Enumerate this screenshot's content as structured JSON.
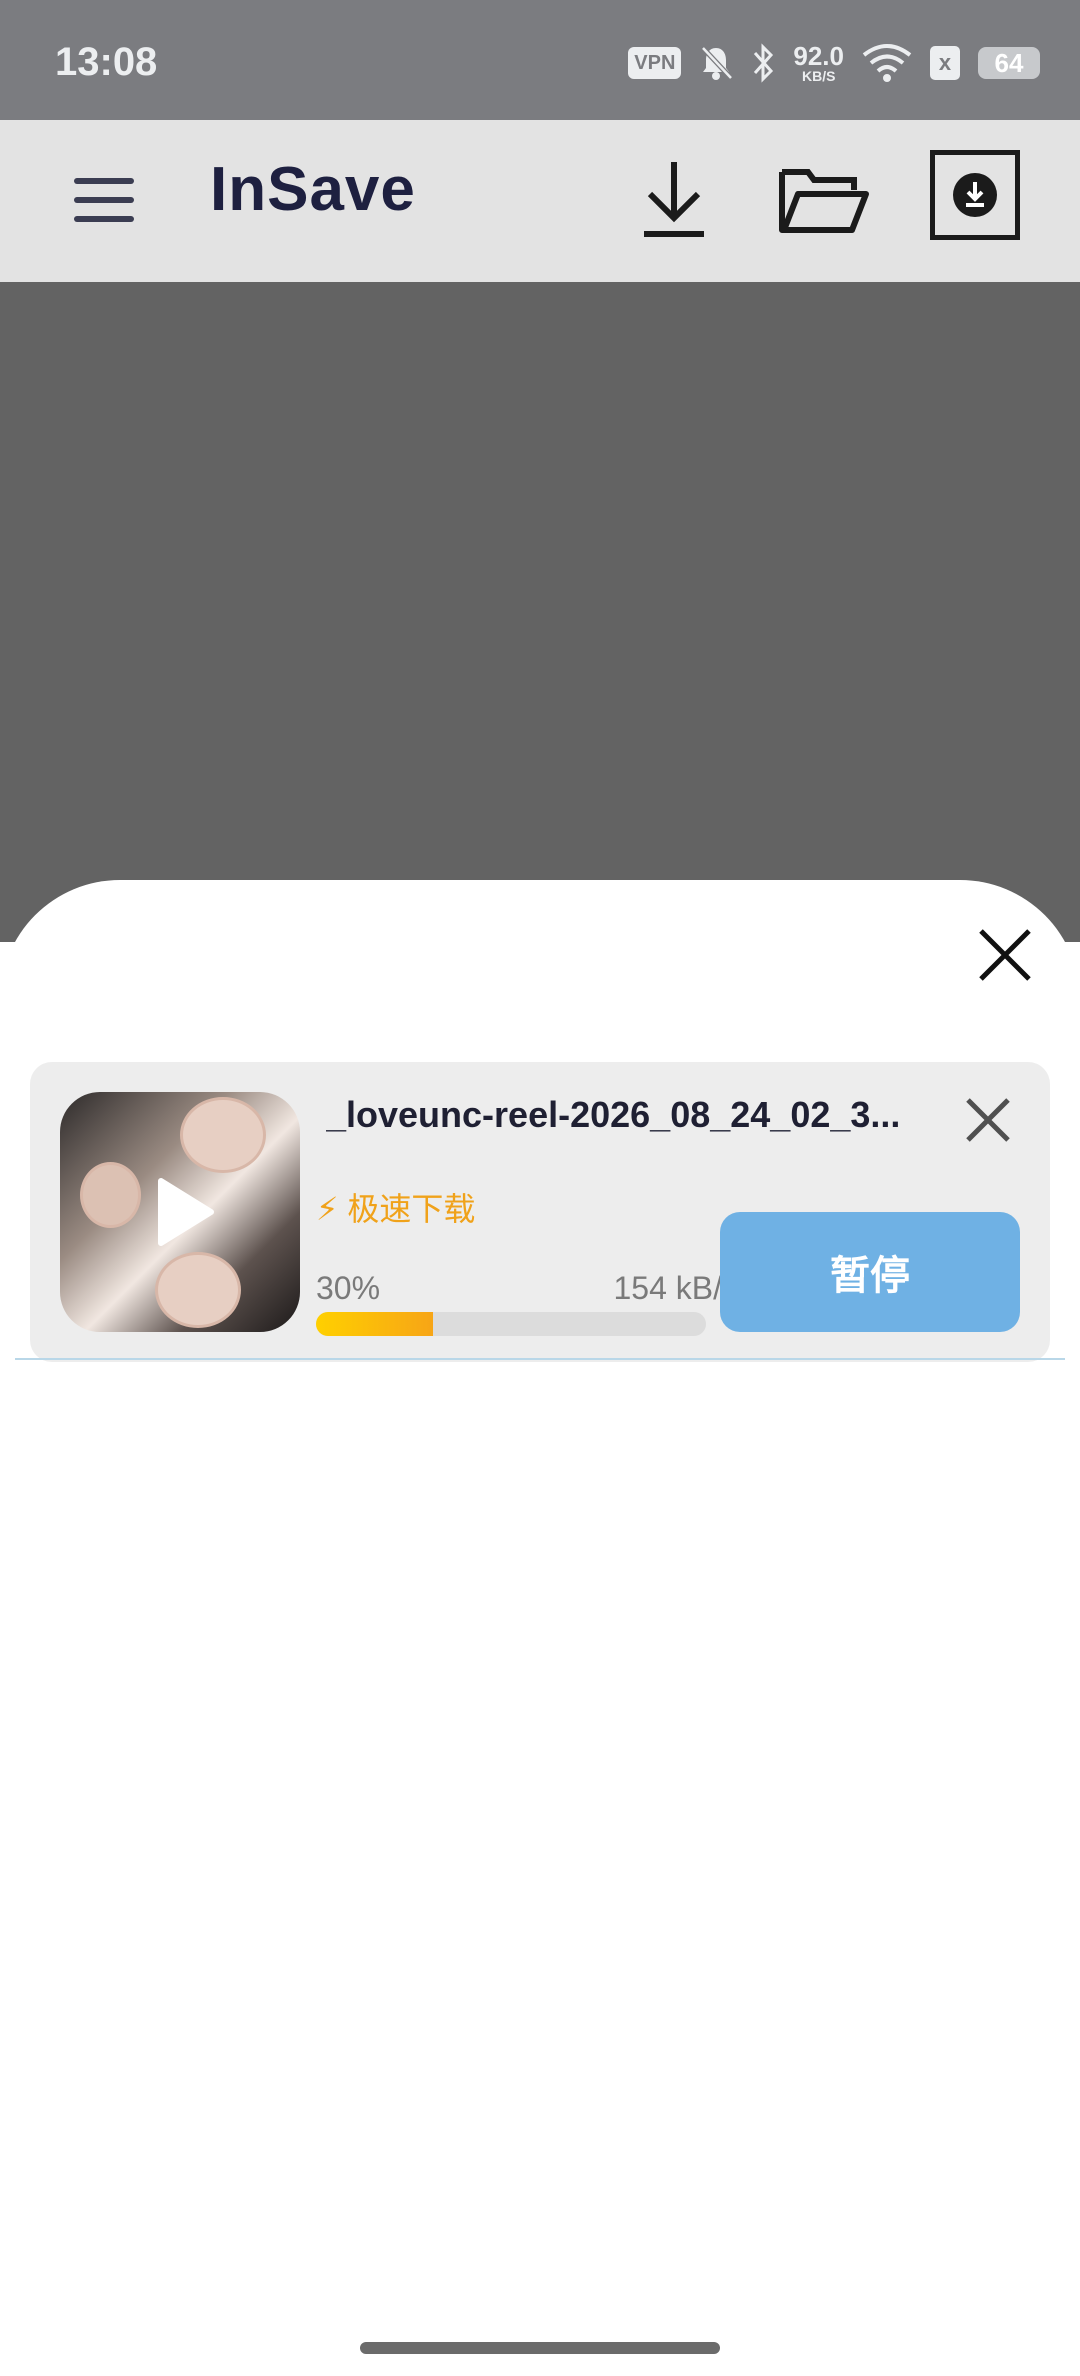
{
  "status_bar": {
    "time": "13:08",
    "vpn": "VPN",
    "net_speed_value": "92.0",
    "net_speed_unit": "KB/S",
    "sim_icon": "x",
    "battery": "64"
  },
  "app_bar": {
    "title": "InSave",
    "icons": [
      "menu-icon",
      "download-arrow-icon",
      "folder-icon",
      "download-box-icon"
    ]
  },
  "sheet": {
    "close_icon": "close-icon"
  },
  "download_item": {
    "file_name": "_loveunc-reel-2026_08_24_02_3...",
    "fast_label": "⚡ 极速下载",
    "percent": "30%",
    "progress": 0.3,
    "speed": "154 kB/s",
    "pause_label": "暂停"
  },
  "colors": {
    "status_bar": "#7b7c80",
    "app_bar": "#e3e3e3",
    "dim": "#636363",
    "accent_blue": "#6fb1e4",
    "accent_orange": "#f0a21a",
    "title_dark": "#1e2040"
  }
}
